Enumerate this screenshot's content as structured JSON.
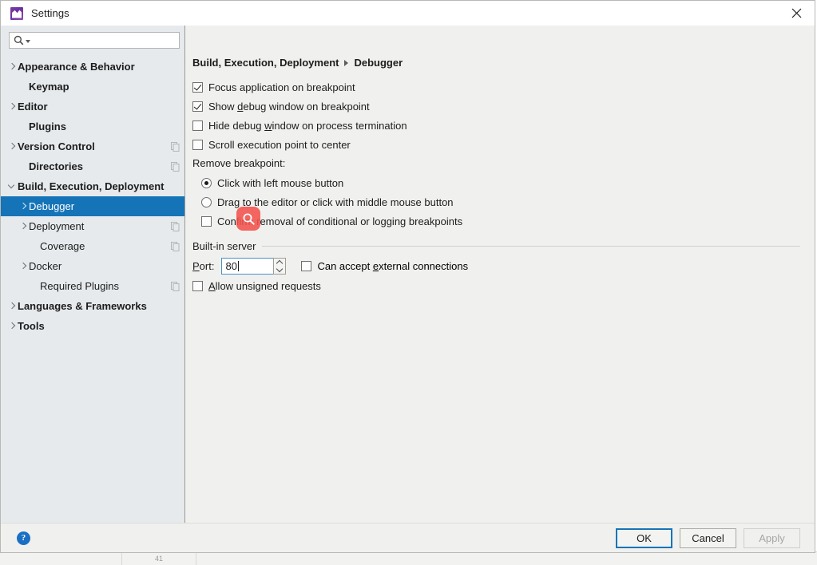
{
  "window": {
    "title": "Settings",
    "app_icon": "phpstorm-icon",
    "close_icon": "close-icon"
  },
  "sidebar": {
    "search": {
      "placeholder": "",
      "value": "",
      "icon": "search-icon",
      "dropdown_icon": "chevron-down-icon"
    },
    "items": [
      {
        "label": "Appearance & Behavior",
        "arrow": "closed",
        "bold": true,
        "indent": 0,
        "copy": false,
        "selected": false
      },
      {
        "label": "Keymap",
        "arrow": "none",
        "bold": true,
        "indent": 1,
        "copy": false,
        "selected": false
      },
      {
        "label": "Editor",
        "arrow": "closed",
        "bold": true,
        "indent": 0,
        "copy": false,
        "selected": false
      },
      {
        "label": "Plugins",
        "arrow": "none",
        "bold": true,
        "indent": 1,
        "copy": false,
        "selected": false
      },
      {
        "label": "Version Control",
        "arrow": "closed",
        "bold": true,
        "indent": 0,
        "copy": true,
        "selected": false
      },
      {
        "label": "Directories",
        "arrow": "none",
        "bold": true,
        "indent": 1,
        "copy": true,
        "selected": false
      },
      {
        "label": "Build, Execution, Deployment",
        "arrow": "open",
        "bold": true,
        "indent": 0,
        "copy": false,
        "selected": false
      },
      {
        "label": "Debugger",
        "arrow": "closed",
        "bold": false,
        "indent": 1,
        "copy": false,
        "selected": true
      },
      {
        "label": "Deployment",
        "arrow": "closed",
        "bold": false,
        "indent": 1,
        "copy": true,
        "selected": false
      },
      {
        "label": "Coverage",
        "arrow": "none",
        "bold": false,
        "indent": 2,
        "copy": true,
        "selected": false
      },
      {
        "label": "Docker",
        "arrow": "closed",
        "bold": false,
        "indent": 1,
        "copy": false,
        "selected": false
      },
      {
        "label": "Required Plugins",
        "arrow": "none",
        "bold": false,
        "indent": 2,
        "copy": true,
        "selected": false
      },
      {
        "label": "Languages & Frameworks",
        "arrow": "closed",
        "bold": true,
        "indent": 0,
        "copy": false,
        "selected": false
      },
      {
        "label": "Tools",
        "arrow": "closed",
        "bold": true,
        "indent": 0,
        "copy": false,
        "selected": false
      }
    ]
  },
  "content": {
    "breadcrumb": {
      "parent": "Build, Execution, Deployment",
      "current": "Debugger"
    },
    "checkboxes_top": [
      {
        "label": "Focus application on breakpoint",
        "checked": true,
        "mnemonic": ""
      },
      {
        "label": "Show debug window on breakpoint",
        "checked": true,
        "mnemonic": "d"
      },
      {
        "label": "Hide debug window on process termination",
        "checked": false,
        "mnemonic": "w"
      },
      {
        "label": "Scroll execution point to center",
        "checked": false,
        "mnemonic": ""
      }
    ],
    "remove_breakpoint": {
      "group_label": "Remove breakpoint:",
      "radios": [
        {
          "label": "Click with left mouse button",
          "checked": true
        },
        {
          "label": "Drag to the editor or click with middle mouse button",
          "checked": false
        }
      ],
      "confirm_checkbox": {
        "label": "Confirm removal of conditional or logging breakpoints",
        "checked": false
      }
    },
    "builtin_server": {
      "section_title": "Built-in server",
      "port_label": "Port:",
      "port_mnemonic": "P",
      "port_value": "80",
      "spinner_up_icon": "chevron-up-icon",
      "spinner_down_icon": "chevron-down-icon",
      "external_checkbox": {
        "label": "Can accept external connections",
        "checked": false,
        "mnemonic": "e"
      },
      "unsigned_checkbox": {
        "label": "Allow unsigned requests",
        "checked": false,
        "mnemonic": "A"
      }
    }
  },
  "cursor_overlay": {
    "icon": "search-cursor-icon",
    "color": "#f4524d"
  },
  "footer": {
    "help_icon": "help-icon",
    "help_glyph": "?",
    "buttons": [
      {
        "label": "OK",
        "style": "primary"
      },
      {
        "label": "Cancel",
        "style": "normal"
      },
      {
        "label": "Apply",
        "style": "disabled"
      }
    ]
  },
  "background": {
    "status_number": "41"
  },
  "colors": {
    "sidebar_bg": "#e6eaed",
    "content_bg": "#f0f0ee",
    "selection": "#1574b8",
    "accent": "#1a6fc4",
    "cursor_red": "#f4524d"
  }
}
